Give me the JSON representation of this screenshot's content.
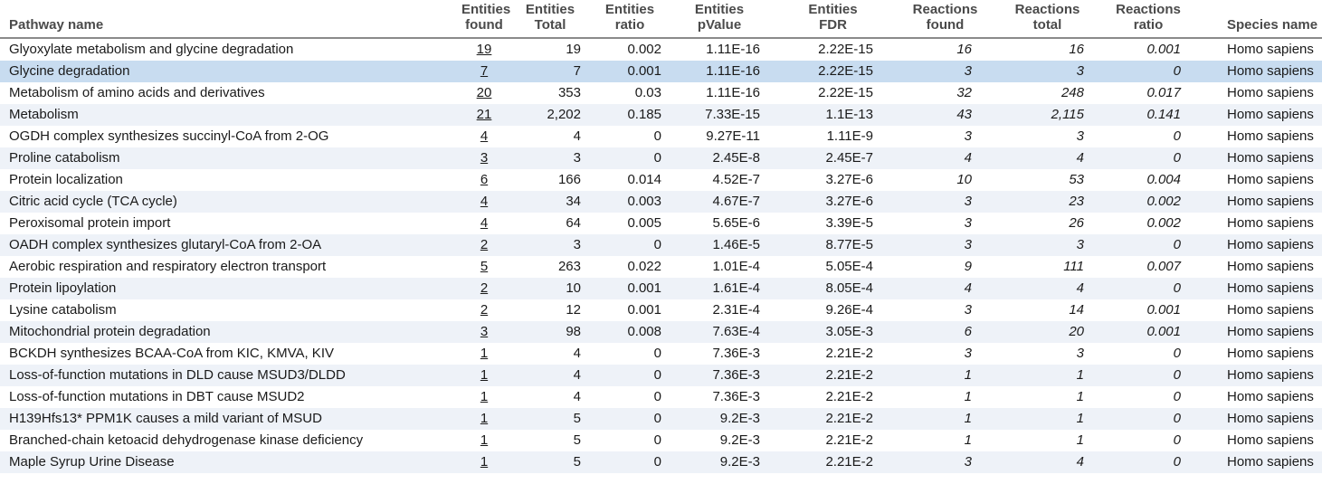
{
  "headers": {
    "pathway_name": "Pathway name",
    "entities_found": [
      "Entities",
      "found"
    ],
    "entities_total": [
      "Entities",
      "Total"
    ],
    "entities_ratio": [
      "Entities",
      "ratio"
    ],
    "entities_pvalue": [
      "Entities",
      "pValue"
    ],
    "entities_fdr": [
      "Entities",
      "FDR"
    ],
    "reactions_found": [
      "Reactions",
      "found"
    ],
    "reactions_total": [
      "Reactions",
      "total"
    ],
    "reactions_ratio": [
      "Reactions",
      "ratio"
    ],
    "species_name": "Species name"
  },
  "selected_row": 1,
  "rows": [
    {
      "name": "Glyoxylate metabolism and glycine degradation",
      "found": "19",
      "total": "19",
      "ratio": "0.002",
      "pvalue": "1.11E-16",
      "fdr": "2.22E-15",
      "r_found": "16",
      "r_total": "16",
      "r_ratio": "0.001",
      "species": "Homo sapiens"
    },
    {
      "name": "Glycine degradation",
      "found": "7",
      "total": "7",
      "ratio": "0.001",
      "pvalue": "1.11E-16",
      "fdr": "2.22E-15",
      "r_found": "3",
      "r_total": "3",
      "r_ratio": "0",
      "species": "Homo sapiens"
    },
    {
      "name": "Metabolism of amino acids and derivatives",
      "found": "20",
      "total": "353",
      "ratio": "0.03",
      "pvalue": "1.11E-16",
      "fdr": "2.22E-15",
      "r_found": "32",
      "r_total": "248",
      "r_ratio": "0.017",
      "species": "Homo sapiens"
    },
    {
      "name": "Metabolism",
      "found": "21",
      "total": "2,202",
      "ratio": "0.185",
      "pvalue": "7.33E-15",
      "fdr": "1.1E-13",
      "r_found": "43",
      "r_total": "2,115",
      "r_ratio": "0.141",
      "species": "Homo sapiens"
    },
    {
      "name": "OGDH complex synthesizes succinyl-CoA from 2-OG",
      "found": "4",
      "total": "4",
      "ratio": "0",
      "pvalue": "9.27E-11",
      "fdr": "1.11E-9",
      "r_found": "3",
      "r_total": "3",
      "r_ratio": "0",
      "species": "Homo sapiens"
    },
    {
      "name": "Proline catabolism",
      "found": "3",
      "total": "3",
      "ratio": "0",
      "pvalue": "2.45E-8",
      "fdr": "2.45E-7",
      "r_found": "4",
      "r_total": "4",
      "r_ratio": "0",
      "species": "Homo sapiens"
    },
    {
      "name": "Protein localization",
      "found": "6",
      "total": "166",
      "ratio": "0.014",
      "pvalue": "4.52E-7",
      "fdr": "3.27E-6",
      "r_found": "10",
      "r_total": "53",
      "r_ratio": "0.004",
      "species": "Homo sapiens"
    },
    {
      "name": "Citric acid cycle (TCA cycle)",
      "found": "4",
      "total": "34",
      "ratio": "0.003",
      "pvalue": "4.67E-7",
      "fdr": "3.27E-6",
      "r_found": "3",
      "r_total": "23",
      "r_ratio": "0.002",
      "species": "Homo sapiens"
    },
    {
      "name": "Peroxisomal protein import",
      "found": "4",
      "total": "64",
      "ratio": "0.005",
      "pvalue": "5.65E-6",
      "fdr": "3.39E-5",
      "r_found": "3",
      "r_total": "26",
      "r_ratio": "0.002",
      "species": "Homo sapiens"
    },
    {
      "name": "OADH complex synthesizes glutaryl-CoA from 2-OA",
      "found": "2",
      "total": "3",
      "ratio": "0",
      "pvalue": "1.46E-5",
      "fdr": "8.77E-5",
      "r_found": "3",
      "r_total": "3",
      "r_ratio": "0",
      "species": "Homo sapiens"
    },
    {
      "name": "Aerobic respiration and respiratory electron transport",
      "found": "5",
      "total": "263",
      "ratio": "0.022",
      "pvalue": "1.01E-4",
      "fdr": "5.05E-4",
      "r_found": "9",
      "r_total": "111",
      "r_ratio": "0.007",
      "species": "Homo sapiens"
    },
    {
      "name": "Protein lipoylation",
      "found": "2",
      "total": "10",
      "ratio": "0.001",
      "pvalue": "1.61E-4",
      "fdr": "8.05E-4",
      "r_found": "4",
      "r_total": "4",
      "r_ratio": "0",
      "species": "Homo sapiens"
    },
    {
      "name": "Lysine catabolism",
      "found": "2",
      "total": "12",
      "ratio": "0.001",
      "pvalue": "2.31E-4",
      "fdr": "9.26E-4",
      "r_found": "3",
      "r_total": "14",
      "r_ratio": "0.001",
      "species": "Homo sapiens"
    },
    {
      "name": "Mitochondrial protein degradation",
      "found": "3",
      "total": "98",
      "ratio": "0.008",
      "pvalue": "7.63E-4",
      "fdr": "3.05E-3",
      "r_found": "6",
      "r_total": "20",
      "r_ratio": "0.001",
      "species": "Homo sapiens"
    },
    {
      "name": "BCKDH synthesizes BCAA-CoA from KIC, KMVA, KIV",
      "found": "1",
      "total": "4",
      "ratio": "0",
      "pvalue": "7.36E-3",
      "fdr": "2.21E-2",
      "r_found": "3",
      "r_total": "3",
      "r_ratio": "0",
      "species": "Homo sapiens"
    },
    {
      "name": "Loss-of-function mutations in DLD cause MSUD3/DLDD",
      "found": "1",
      "total": "4",
      "ratio": "0",
      "pvalue": "7.36E-3",
      "fdr": "2.21E-2",
      "r_found": "1",
      "r_total": "1",
      "r_ratio": "0",
      "species": "Homo sapiens"
    },
    {
      "name": "Loss-of-function mutations in DBT cause MSUD2",
      "found": "1",
      "total": "4",
      "ratio": "0",
      "pvalue": "7.36E-3",
      "fdr": "2.21E-2",
      "r_found": "1",
      "r_total": "1",
      "r_ratio": "0",
      "species": "Homo sapiens"
    },
    {
      "name": "H139Hfs13* PPM1K causes a mild variant of MSUD",
      "found": "1",
      "total": "5",
      "ratio": "0",
      "pvalue": "9.2E-3",
      "fdr": "2.21E-2",
      "r_found": "1",
      "r_total": "1",
      "r_ratio": "0",
      "species": "Homo sapiens"
    },
    {
      "name": "Branched-chain ketoacid dehydrogenase kinase deficiency",
      "found": "1",
      "total": "5",
      "ratio": "0",
      "pvalue": "9.2E-3",
      "fdr": "2.21E-2",
      "r_found": "1",
      "r_total": "1",
      "r_ratio": "0",
      "species": "Homo sapiens"
    },
    {
      "name": "Maple Syrup Urine Disease",
      "found": "1",
      "total": "5",
      "ratio": "0",
      "pvalue": "9.2E-3",
      "fdr": "2.21E-2",
      "r_found": "3",
      "r_total": "4",
      "r_ratio": "0",
      "species": "Homo sapiens"
    }
  ]
}
